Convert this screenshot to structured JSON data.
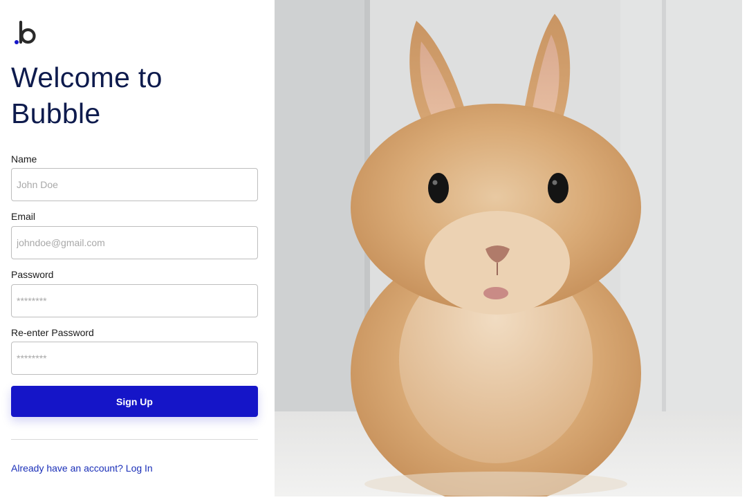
{
  "app": {
    "title_line1": "Welcome to",
    "title_line2": "Bubble"
  },
  "logo": {
    "icon": "bubble-logo-icon",
    "letter": "b",
    "dot_color": "#1515c8"
  },
  "form": {
    "name": {
      "label": "Name",
      "placeholder": "John Doe",
      "value": ""
    },
    "email": {
      "label": "Email",
      "placeholder": "johndoe@gmail.com",
      "value": ""
    },
    "password": {
      "label": "Password",
      "placeholder": "********",
      "value": ""
    },
    "reenter_password": {
      "label": "Re-enter Password",
      "placeholder": "********",
      "value": ""
    },
    "submit_label": "Sign Up"
  },
  "footer": {
    "login_link": "Already have an account? Log In"
  },
  "hero": {
    "image": "rabbit-photo"
  },
  "colors": {
    "primary": "#1515c8",
    "title": "#0e1b4d",
    "link": "#1a2fb8"
  }
}
